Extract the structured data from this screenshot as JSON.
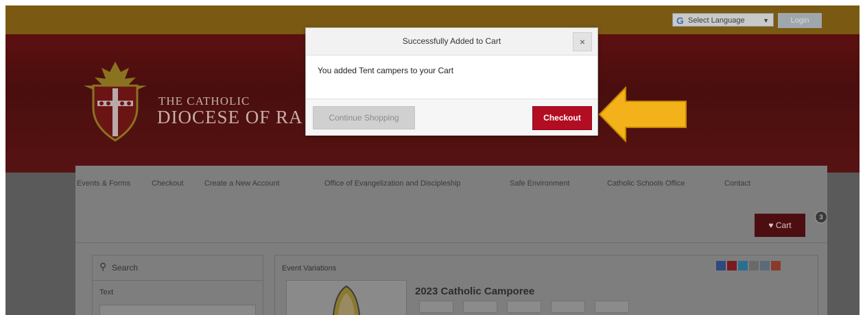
{
  "top": {
    "language_label": "Select Language",
    "login_label": "Login"
  },
  "banner": {
    "line1": "THE CATHOLIC",
    "line2": "DIOCESE OF RA"
  },
  "nav": {
    "items": [
      "Events & Forms",
      "Checkout",
      "Create a New Account",
      "Office of Evangelization and Discipleship",
      "Safe Environment",
      "Catholic Schools Office",
      "Contact"
    ]
  },
  "cart": {
    "label": "Cart",
    "count": "3"
  },
  "search": {
    "title": "Search",
    "text_label": "Text"
  },
  "event": {
    "header": "Event Variations",
    "title": "2023 Catholic Camporee"
  },
  "modal": {
    "title": "Successfully Added to Cart",
    "close": "×",
    "message": "You added Tent campers to your Cart",
    "continue_label": "Continue Shopping",
    "checkout_label": "Checkout"
  },
  "colors": {
    "brand_red": "#b30d23",
    "arrow": "#f4b21a",
    "header_gold": "#7a5a12"
  },
  "icons": [
    "google-icon",
    "dropdown-arrow-icon",
    "cart-icon",
    "search-icon",
    "close-icon",
    "arrow-icon",
    "facebook-icon",
    "pinterest-icon",
    "twitter-icon",
    "email-icon",
    "print-icon",
    "share-icon"
  ]
}
